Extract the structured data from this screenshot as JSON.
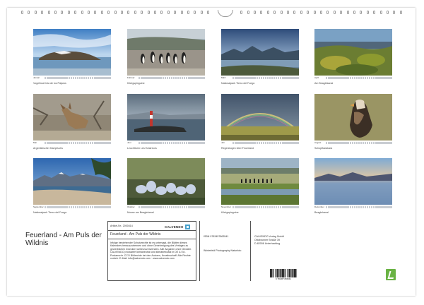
{
  "footer": {
    "title": "Feuerland - Am Puls der Wildnis",
    "article_no": "Artikel-Nr.: 2000414",
    "calendar_name": "Feuerland - Am Puls der Wildnis",
    "description": "Infolge bestehender Schutzrechte ist es untersagt, die Blätter dieses Kalenders herauszutrennen und ohne Genehmigung des Verlages zu gewerblichen Zwecken weiterzuverwenden. Alle Angaben ohne Gewähr. CALVENDO produziert klimaneutral und klimabewusst in DE & EU. Postanschr. CCO Bildrechte bei den Autoren, Kreativschaff. Alle Rechte vorbeh. E-Mail: info@calvendo.com · www.calvendo.com",
    "isbn": "ISBN 9783457863541",
    "author": "Winterfeld Photography Naturfoto",
    "publisher": "CALVENDO Verlag GmbH",
    "street": "Ottobrunner Straße 39",
    "city": "D-82008 Unterhaching",
    "logo_text": "CALVENDO",
    "barcode_number": "9 783457 863541"
  },
  "months": [
    {
      "name": "Januar",
      "caption": "Vogelinsel Isla de los Pájaros"
    },
    {
      "name": "Februar",
      "caption": "Königspinguine"
    },
    {
      "name": "März",
      "caption": "Nationalpark Tierra del Fuego"
    },
    {
      "name": "April",
      "caption": "Am Beaglekanal"
    },
    {
      "name": "Mai",
      "caption": "Argentinischer Kampfuchs"
    },
    {
      "name": "Juni",
      "caption": "Leuchtturm Les Eclaireurs"
    },
    {
      "name": "Juli",
      "caption": "Regenbogen über Feuerland"
    },
    {
      "name": "August",
      "caption": "Schopfkarakara"
    },
    {
      "name": "September",
      "caption": "Nationalpark Tierra del Fuego"
    },
    {
      "name": "Oktober",
      "caption": "Moose am Beaglekanal"
    },
    {
      "name": "November",
      "caption": "Königspinguine"
    },
    {
      "name": "Dezember",
      "caption": "Beaglekanal"
    }
  ]
}
